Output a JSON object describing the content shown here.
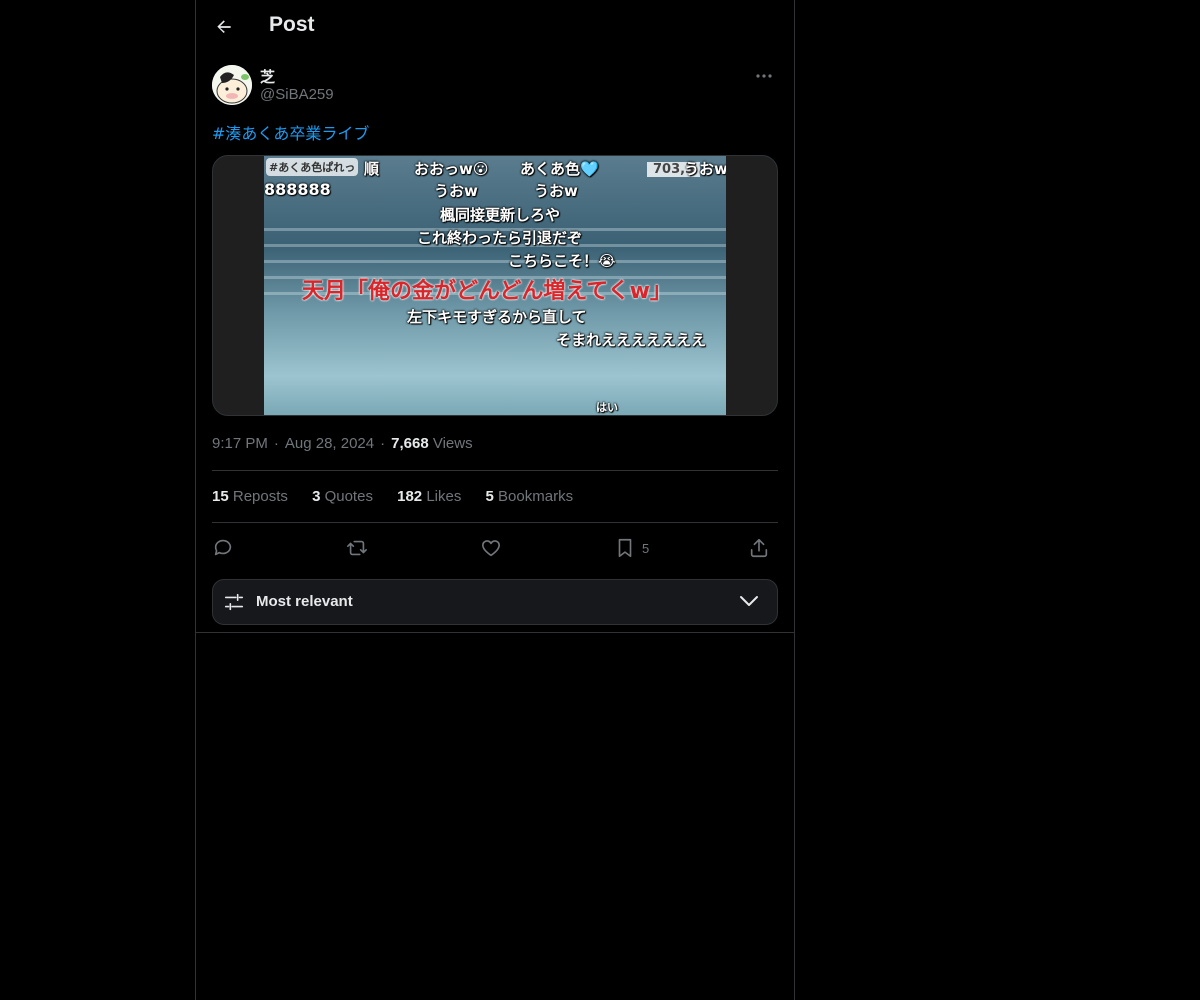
{
  "header": {
    "title": "Post"
  },
  "author": {
    "display_name": "芝",
    "handle": "@SiBA259"
  },
  "post": {
    "hashtag": "#湊あくあ卒業ライブ",
    "media": {
      "overlay_texts": {
        "tag_top": "#あくあ色ぱれっ",
        "seq": "順",
        "ooo": "おおっw😮",
        "aqua_color": "あくあ色🩵",
        "viewers": "703,3",
        "uo_right": "うおw",
        "claps": "888888",
        "uow1": "うおw",
        "uow2": "うおw",
        "kaede": "楓同接更新しろや",
        "kore": "これ終わったら引退だぞ",
        "kochira": "こちらこそ！😭",
        "red_line": "天月「俺の金がどんどん増えてくw」",
        "hidari": "左下キモすぎるから直して",
        "somare": "そまれえええええええ",
        "hai": "はい"
      }
    },
    "time": "9:17 PM",
    "date": "Aug 28, 2024",
    "views_count": "7,668",
    "views_label": "Views"
  },
  "stats": {
    "reposts_count": "15",
    "reposts_label": "Reposts",
    "quotes_count": "3",
    "quotes_label": "Quotes",
    "likes_count": "182",
    "likes_label": "Likes",
    "bookmarks_count": "5",
    "bookmarks_label": "Bookmarks"
  },
  "actions": {
    "bookmark_count": "5"
  },
  "sort": {
    "label": "Most relevant"
  },
  "colors": {
    "background": "#000000",
    "border": "#2f3336",
    "text_primary": "#e7e9ea",
    "text_secondary": "#71767b",
    "link": "#1d9bf0"
  }
}
